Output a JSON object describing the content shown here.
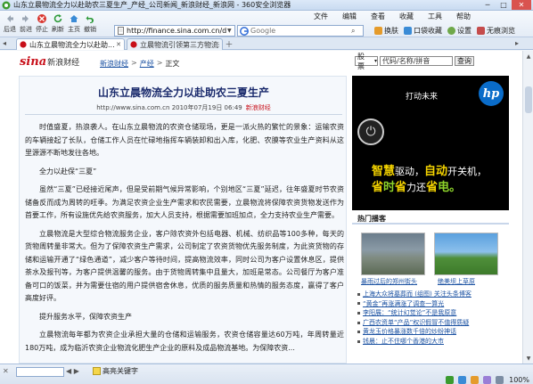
{
  "titlebar": {
    "title": "山东立晨物流全力以赴助农三夏生产_产经_公司新闻_新浪财经_新浪网 - 360安全浏览器",
    "minimize": "─",
    "maximize": "□",
    "close": "✕"
  },
  "menu": [
    "文件",
    "编辑",
    "查看",
    "收藏",
    "工具",
    "帮助"
  ],
  "nav": {
    "back": "后退",
    "forward": "前进",
    "stop": "停止",
    "refresh": "刷新",
    "home": "主页",
    "undo": "撤销"
  },
  "address": {
    "url": "http://finance.sina.com.cn/d"
  },
  "search": {
    "placeholder": "Google"
  },
  "tools": [
    "换肤",
    "口袋收藏",
    "设置",
    "无痕浏览"
  ],
  "tabs": [
    {
      "label": "山东立晨物流全力以赴助...",
      "active": true
    },
    {
      "label": "立晨物流引领第三方物流新模...",
      "active": false
    }
  ],
  "page": {
    "logo_sina": "sina",
    "logo_finance": "新浪财经",
    "breadcrumb": [
      "新浪财经",
      "产经",
      "正文"
    ],
    "stock_select": "股票",
    "stock_input": "代码/名称/拼音",
    "stock_button": "查询",
    "headline": "山东立晨物流全力以赴助农三夏生产",
    "meta_source": "http://www.sina.com.cn  2010年07月19日 06:49",
    "meta_comment": "新浪财经",
    "paragraphs": [
      "时值盛夏，热浪袭人。在山东立晨物流的农资仓储现场，更是一派火热的繁忙的景象：运输农资的车辆接起了长队，仓储工作人员在忙碌地指挥车辆装卸和出入库，化肥、农膜等农业生产资料从这里源源不断地发往各地。",
      "全力以赴保“三夏”",
      "虽然“三夏”已经接近尾声，但是受前期气候异常影响，个别地区“三夏”延迟，往年盛夏时节农资储备反而成为周转的旺季。为满足农资企业生产需求和农民需要，立晨物流将保障农资货物发送作为首要工作，所有设施优先给农资服务，加大人员支持，根据需要加班加点，全力支持农业生产需要。",
      "立晨物流是大型综合物流服务企业，客户除农资外包括电器、机械、纺织品等100多种，每天的货物周转量非常大。但为了保障农资生产需求，公司制定了农资货物优先服务制度，为此资货物的存储和运输开通了“绿色通道”，减少客户等待时间，提高物流效率，同时公司为客户设置休息区，提供茶水及报刊等，为客户提供温馨的服务。由于货物周转集中且量大，加班是常态。公司餐厅为客户准备可口的饭菜，并为需要住宿的用户提供宿舍休息，优质的服务质量和热情的服务态度，赢得了客户高度好评。",
      "提升服务水平，保障农资生产",
      "立晨物流每年都为农资企业承担大量的仓储和运输服务，农资仓储容量达60万吨，年周转量近180万吨，成为临沂农资企业物流化肥生产企业的原料及成品物流基地。为保障农资..."
    ],
    "ad": {
      "slogan": "打动未来",
      "brand": "hp",
      "line1_a": "智慧",
      "line1_b": "驱动，",
      "line1_c": "自动",
      "line1_d": "开关机，",
      "line2_a": "省",
      "line2_b": "时",
      "line2_c": "省",
      "line2_d": "力还",
      "line2_e": "省",
      "line2_f": "电。"
    },
    "hot": {
      "title": "热门播客",
      "captions": [
        "暴雨过后的郑州街头",
        "绝美坝上草原"
      ],
      "links": [
        "上海大众将墓葬而 (组图) 关注头条博客",
        "“黄金”再涨满涨了调查一算光",
        "李阳展：“统计幻觉论”不是我原意",
        "广西农资单“产品”权识假冒不值得质疑",
        "黄龙玉价格暴涨数千倍的炒纷神话",
        "钱晨：止不住哪个香港的大市"
      ]
    }
  },
  "status": {
    "highlight": "高亮关键字",
    "find_prev": "◀",
    "find_next": "▶",
    "zoom": "100%"
  }
}
